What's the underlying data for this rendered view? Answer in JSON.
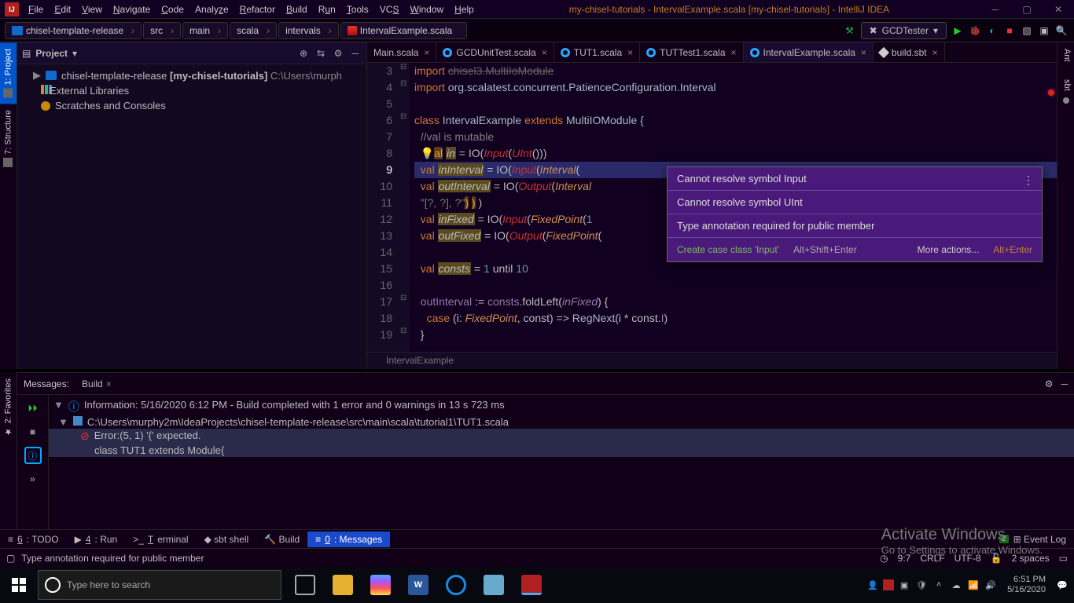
{
  "title": "my-chisel-tutorials - IntervalExample.scala [my-chisel-tutorials] - IntelliJ IDEA",
  "menu": [
    "File",
    "Edit",
    "View",
    "Navigate",
    "Code",
    "Analyze",
    "Refactor",
    "Build",
    "Run",
    "Tools",
    "VCS",
    "Window",
    "Help"
  ],
  "breadcrumb": [
    "chisel-template-release",
    "src",
    "main",
    "scala",
    "intervals",
    "IntervalExample.scala"
  ],
  "runConfig": "GCDTester",
  "leftTabs": [
    {
      "label": "1: Project",
      "active": true
    },
    {
      "label": "7: Structure",
      "active": false
    }
  ],
  "rightTabs": [
    "Ant",
    "sbt"
  ],
  "projectPanel": {
    "title": "Project",
    "tree": [
      {
        "label": "chisel-template-release",
        "bold": "[my-chisel-tutorials]",
        "suffix": "  C:\\Users\\murph"
      },
      {
        "label": "External Libraries"
      },
      {
        "label": "Scratches and Consoles"
      }
    ]
  },
  "editorTabs": [
    {
      "label": "Main.scala",
      "icon": "scala"
    },
    {
      "label": "GCDUnitTest.scala",
      "icon": "sc"
    },
    {
      "label": "TUT1.scala",
      "icon": "sc"
    },
    {
      "label": "TUTTest1.scala",
      "icon": "sc"
    },
    {
      "label": "IntervalExample.scala",
      "icon": "sc",
      "active": true
    },
    {
      "label": "build.sbt",
      "icon": "sbt"
    }
  ],
  "code": {
    "lines": [
      3,
      4,
      5,
      6,
      7,
      8,
      9,
      10,
      11,
      12,
      13,
      14,
      15,
      16,
      17,
      18,
      19
    ],
    "current": 9,
    "rows": [
      "import chisel3.MultiIoModule",
      "import org.scalatest.concurrent.PatienceConfiguration.Interval",
      "",
      "class IntervalExample extends MultiIOModule {",
      "  //val is mutable",
      "  val in = IO(Input(UInt()))",
      "  val inInterval = IO(Input(Interval(",
      "  val outInterval = IO(Output(Interval",
      "  \"[?, ?], ?\") ) )",
      "  val inFixed = IO(Input(FixedPoint(1",
      "  val outFixed = IO(Output(FixedPoint(",
      "",
      "  val consts = 1 until 10",
      "",
      "  outInterval := consts.foldLeft(inFixed) {",
      "    case (i: FixedPoint, const) => RegNext(i * const.I)",
      "  }"
    ]
  },
  "breadcrumbBottom": "IntervalExample",
  "popup": {
    "rows": [
      "Cannot resolve symbol Input",
      "Cannot resolve symbol UInt",
      "Type annotation required for public member"
    ],
    "action1": "Create case class 'Input'",
    "short1": "Alt+Shift+Enter",
    "action2": "More actions...",
    "short2": "Alt+Enter"
  },
  "messages": {
    "title": "Messages:",
    "tab": "Build",
    "rows": [
      {
        "type": "info",
        "text": "Information: 5/16/2020 6:12 PM - Build completed with 1 error and 0 warnings in 13 s 723 ms"
      },
      {
        "type": "file",
        "text": "C:\\Users\\murphy2m\\IdeaProjects\\chisel-template-release\\src\\main\\scala\\tutorial1\\TUT1.scala"
      },
      {
        "type": "err",
        "text": "Error:(5, 1)  '{' expected."
      },
      {
        "type": "plain",
        "text": "class TUT1 extends Module{"
      }
    ]
  },
  "favTab": {
    "label": "2: Favorites"
  },
  "toolWindows": [
    {
      "label": "6: TODO",
      "icon": "≡"
    },
    {
      "label": "4: Run",
      "icon": "▶"
    },
    {
      "label": "Terminal",
      "icon": ">_"
    },
    {
      "label": "sbt shell",
      "icon": "◆"
    },
    {
      "label": "Build",
      "icon": "🔨"
    },
    {
      "label": "0: Messages",
      "icon": "≡",
      "active": true
    }
  ],
  "status": {
    "msg": "Type annotation required for public member",
    "pos": "9:7",
    "eol": "CRLF",
    "enc": "UTF-8",
    "indent": "2 spaces",
    "eventCount": "2",
    "eventLabel": "Event Log"
  },
  "watermark": {
    "l1": "Activate Windows",
    "l2": "Go to Settings to activate Windows."
  },
  "taskbar": {
    "search": "Type here to search",
    "time": "6:51 PM",
    "date": "5/16/2020"
  }
}
